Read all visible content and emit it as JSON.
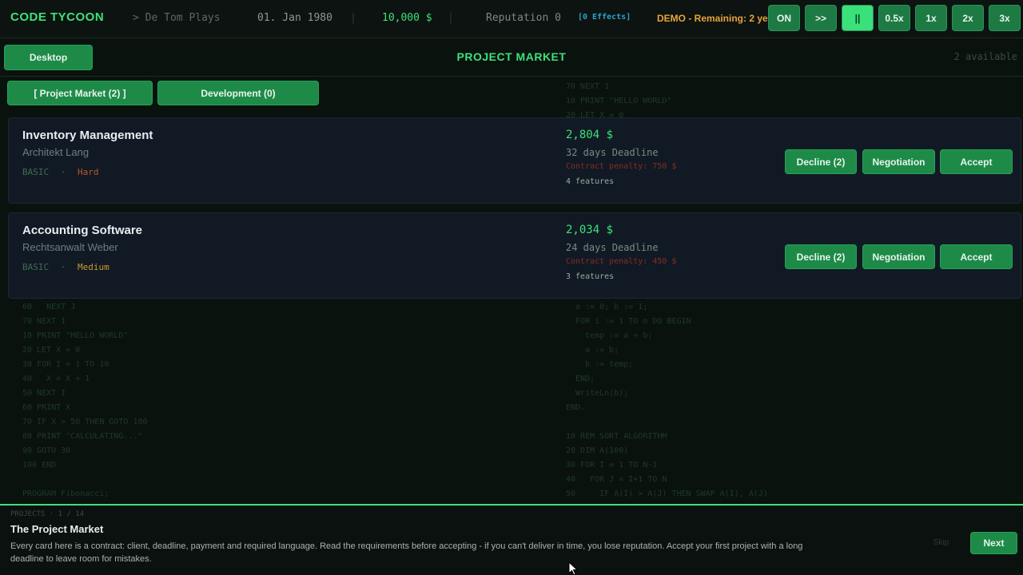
{
  "background_code": {
    "left": "60   NEXT J\n70 NEXT 1\n10 PRINT \"HELLO WORLD\"\n20 LET X = 0\n30 FOR I = 1 TO 10\n40   X = X + 1\n50 NEXT I\n60 PRINT X\n70 IF X > 50 THEN GOTO 100\n80 PRINT \"CALCULATING...\"\n90 GOTO 30\n100 END\n\nPROGRAM Fibonacci;",
    "right_top": "70 NEXT 1\n10 PRINT \"HELLO WORLD\"\n20 LET X = 0",
    "right_bottom": "  a := 0; b := 1;\n  FOR i := 1 TO n DO BEGIN\n    temp := a + b;\n    a := b;\n    b := temp;\n  END;\n  WriteLn(b);\nEND.\n\n10 REM SORT ALGORITHM\n20 DIM A(100)\n30 FOR I = 1 TO N-1\n40   FOR J = I+1 TO N\n50     IF A(I) > A(J) THEN SWAP A(I), A(J)"
  },
  "topbar": {
    "brand": "CODE TYCOON",
    "player": "> De Tom Plays",
    "date": "01. Jan 1980",
    "separator": "|",
    "money": "10,000 $",
    "reputation": "Reputation 0",
    "effects": "[0 Effects]",
    "demo": "DEMO - Remaining: 2 ye",
    "speed_buttons": [
      "ON",
      ">>",
      "||",
      "0.5x",
      "1x",
      "2x",
      "3x"
    ],
    "active_speed": "||"
  },
  "subbar": {
    "desktop_label": "Desktop",
    "title": "PROJECT MARKET",
    "available": "2 available"
  },
  "tabs": [
    {
      "label": "[ Project Market (2) ]"
    },
    {
      "label": "Development (0)"
    }
  ],
  "projects": [
    {
      "title": "Inventory Management",
      "client": "Architekt Lang",
      "level": "BASIC",
      "dot": "·",
      "difficulty": "Hard",
      "pay": "2,804 $",
      "deadline": "32 days Deadline",
      "penalty": "Contract penalty: 750 $",
      "features": "4 features",
      "decline_label": "Decline (2)",
      "negotiation_label": "Negotiation",
      "accept_label": "Accept"
    },
    {
      "title": "Accounting Software",
      "client": "Rechtsanwalt Weber",
      "level": "BASIC",
      "dot": "·",
      "difficulty": "Medium",
      "pay": "2,034 $",
      "deadline": "24 days Deadline",
      "penalty": "Contract penalty: 450 $",
      "features": "3 features",
      "decline_label": "Decline (2)",
      "negotiation_label": "Negotiation",
      "accept_label": "Accept"
    }
  ],
  "tutorial": {
    "meta": "PROJECTS  ·  1 / 14",
    "title": "The Project Market",
    "body": "Every card here is a contract: client, deadline, payment and required language. Read the requirements before accepting - if you can't deliver in time, you lose reputation. Accept your first project with a long deadline to leave room for mistakes.",
    "skip_label": "Skip",
    "next_label": "Next"
  },
  "colors": {
    "accent": "#3ee07a",
    "button": "#1d8a48",
    "warning": "#e8a33a",
    "penalty": "#8a2a22",
    "hard": "#b8562e",
    "medium": "#c99a2e"
  }
}
